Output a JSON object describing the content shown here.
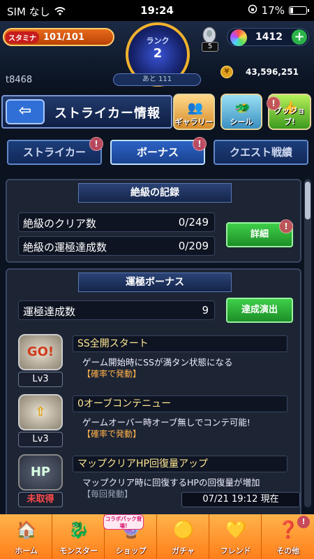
{
  "status_bar": {
    "carrier": "SIM なし",
    "time": "19:24",
    "battery": "17%"
  },
  "header": {
    "stamina_label": "スタミナ",
    "stamina_value": "101/101",
    "rank_label": "ランク",
    "rank_value": "2",
    "next_rank": "あと 111",
    "egg_count": "5",
    "orbs": "1412",
    "user_id": "t8468",
    "coins": "43,596,251"
  },
  "title_row": {
    "title": "ストライカー情報",
    "quick_buttons": [
      {
        "label": "ギャラリー",
        "icon": "gallery-icon"
      },
      {
        "label": "シール",
        "icon": "seal-icon"
      },
      {
        "label": "グッジョブ!",
        "icon": "goodjob-icon"
      }
    ],
    "badge_text": "!"
  },
  "tabs": [
    {
      "label": "ストライカー",
      "active": false
    },
    {
      "label": "ボーナス",
      "active": true
    },
    {
      "label": "クエスト戦績",
      "active": false
    }
  ],
  "records": {
    "heading": "絶級の記録",
    "rows": [
      {
        "label": "絶級のクリア数",
        "value": "0/249"
      },
      {
        "label": "絶級の運極達成数",
        "value": "0/209"
      }
    ],
    "detail_button": "詳細"
  },
  "unkiwame": {
    "heading": "運極ボーナス",
    "count_label": "運極達成数",
    "count_value": "9",
    "effect_button": "達成演出"
  },
  "bonuses": [
    {
      "icon_text": "GO!",
      "level": "Lv3",
      "name": "SS全開スタート",
      "desc": "ゲーム開始時にSSが満タン状態になる",
      "cond": "【確率で発動】"
    },
    {
      "icon_text": "⇧",
      "level": "Lv3",
      "name": "0オーブコンテニュー",
      "desc": "ゲームオーバー時オーブ無しでコンテ可能!",
      "cond": "【確率で発動】"
    },
    {
      "icon_text": "HP",
      "level": "未取得",
      "name": "マップクリアHP回復量アップ",
      "desc": "マップクリア時に回復するHPの回復量が増加",
      "cond": "【毎回発動】"
    }
  ],
  "timestamp": "07/21 19:12 現在",
  "nav": {
    "collab_tag": "コラボパック登場!",
    "items": [
      {
        "label": "ホーム",
        "icon": "home-icon"
      },
      {
        "label": "モンスター",
        "icon": "monster-icon"
      },
      {
        "label": "ショップ",
        "icon": "shop-icon"
      },
      {
        "label": "ガチャ",
        "icon": "gacha-icon"
      },
      {
        "label": "フレンド",
        "icon": "friend-icon"
      },
      {
        "label": "その他",
        "icon": "other-icon"
      }
    ]
  },
  "colors": {
    "accent_orange": "#ff8a1a",
    "active_tab": "#2c63c6",
    "green_button": "#2fbf3a",
    "warning_red": "#ff4b4b"
  }
}
